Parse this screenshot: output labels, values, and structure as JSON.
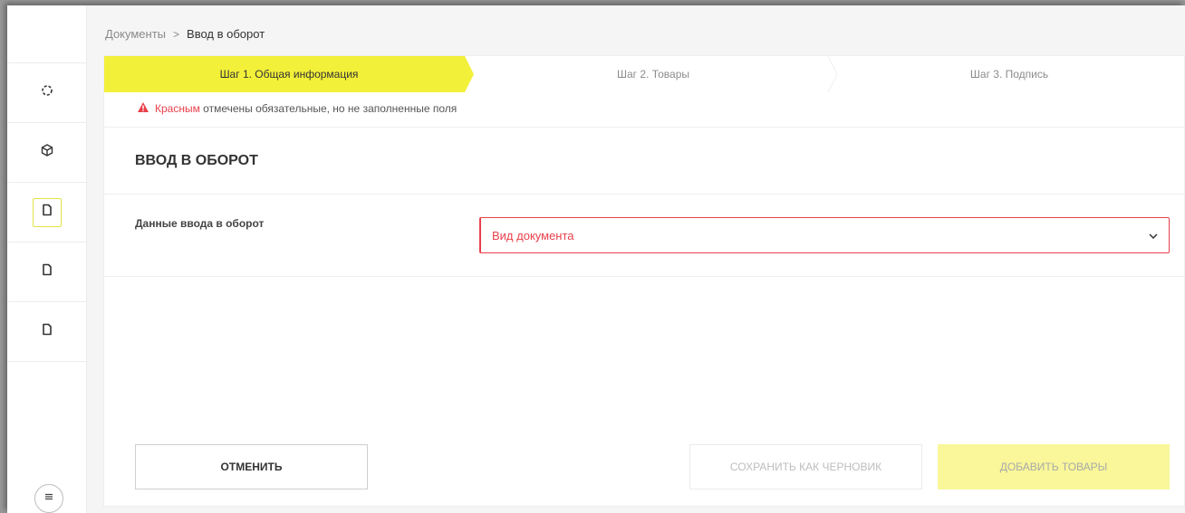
{
  "breadcrumb": {
    "parent": "Документы",
    "separator": ">",
    "current": "Ввод в оборот"
  },
  "steps": [
    {
      "label": "Шаг 1. Общая информация",
      "active": true
    },
    {
      "label": "Шаг 2. Товары",
      "active": false
    },
    {
      "label": "Шаг 3. Подпись",
      "active": false
    }
  ],
  "warning": {
    "highlight": "Красным",
    "text": " отмечены обязательные, но не заполненные поля"
  },
  "form": {
    "title": "ВВОД В ОБОРОТ",
    "field_label": "Данные ввода в оборот",
    "select_placeholder": "Вид документа"
  },
  "buttons": {
    "cancel": "ОТМЕНИТЬ",
    "draft": "СОХРАНИТЬ КАК ЧЕРНОВИК",
    "add": "ДОБАВИТЬ ТОВАРЫ"
  },
  "sidebar": {
    "items": [
      {
        "icon": "loader-icon"
      },
      {
        "icon": "box-icon"
      },
      {
        "icon": "document-icon",
        "active": true
      },
      {
        "icon": "document-icon"
      },
      {
        "icon": "document-icon"
      }
    ],
    "menu_icon": "menu-icon"
  },
  "colors": {
    "accent": "#f3f03a",
    "error": "#e8414b"
  }
}
